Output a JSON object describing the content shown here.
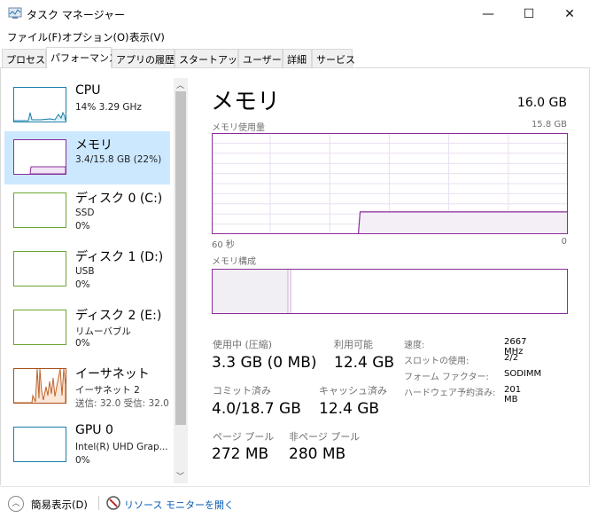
{
  "window": {
    "title": "タスク マネージャー",
    "minimize": "—",
    "maximize": "☐",
    "close": "✕"
  },
  "menu": [
    "ファイル(F)",
    "オプション(O)",
    "表示(V)"
  ],
  "tabs": [
    "プロセス",
    "パフォーマンス",
    "アプリの履歴",
    "スタートアップ",
    "ユーザー",
    "詳細",
    "サービス"
  ],
  "sidebar": [
    {
      "name": "CPU",
      "sub1": "14%  3.29 GHz",
      "color": "#1a7ea8"
    },
    {
      "name": "メモリ",
      "sub1": "3.4/15.8 GB (22%)",
      "color": "#8b2c9a"
    },
    {
      "name": "ディスク 0 (C:)",
      "sub1": "SSD",
      "sub2": "0%",
      "color": "#6aa630"
    },
    {
      "name": "ディスク 1 (D:)",
      "sub1": "USB",
      "sub2": "0%",
      "color": "#6aa630"
    },
    {
      "name": "ディスク 2 (E:)",
      "sub1": "リムーバブル",
      "sub2": "0%",
      "color": "#6aa630"
    },
    {
      "name": "イーサネット",
      "sub1": "イーサネット 2",
      "sub2": "送信: 32.0 受信: 32.0",
      "color": "#a7501a"
    },
    {
      "name": "GPU 0",
      "sub1": "Intel(R) UHD Grap...",
      "sub2": "0%",
      "color": "#1a7ea8"
    }
  ],
  "main": {
    "title": "メモリ",
    "total": "16.0 GB",
    "usage_label": "メモリ使用量",
    "usage_max": "15.8 GB",
    "time_left": "60 秒",
    "time_right": "0",
    "composition_label": "メモリ構成",
    "in_use_label": "使用中 (圧縮)",
    "in_use": "3.3 GB (0 MB)",
    "available_label": "利用可能",
    "available": "12.4 GB",
    "committed_label": "コミット済み",
    "committed": "4.0/18.7 GB",
    "cached_label": "キャッシュ済み",
    "cached": "12.4 GB",
    "paged_label": "ページ プール",
    "paged": "272 MB",
    "nonpaged_label": "非ページ プール",
    "nonpaged": "280 MB",
    "details": [
      {
        "k": "速度:",
        "v": "2667 MHz"
      },
      {
        "k": "スロットの使用:",
        "v": "2/2"
      },
      {
        "k": "フォーム ファクター:",
        "v": "SODIMM"
      },
      {
        "k": "ハードウェア予約済み:",
        "v": "201 MB"
      }
    ],
    "usage_history_gb": [
      0,
      0,
      0,
      0,
      0,
      0,
      0,
      0,
      0,
      0,
      0,
      0,
      0,
      0,
      0,
      0,
      0,
      0,
      0,
      0,
      0,
      0,
      0,
      0,
      0,
      3.4,
      3.4,
      3.4,
      3.4,
      3.4,
      3.4,
      3.4,
      3.4,
      3.4,
      3.4,
      3.4,
      3.4,
      3.4,
      3.4,
      3.4,
      3.4,
      3.4,
      3.4,
      3.4,
      3.4,
      3.4,
      3.4,
      3.4,
      3.4,
      3.4,
      3.4,
      3.4,
      3.4,
      3.4,
      3.4,
      3.4,
      3.4,
      3.4,
      3.4,
      3.4,
      3.4
    ],
    "accent": "#8b2c9a"
  },
  "footer": {
    "fewer": "簡易表示(D)",
    "resmon": "リソース モニターを開く"
  }
}
